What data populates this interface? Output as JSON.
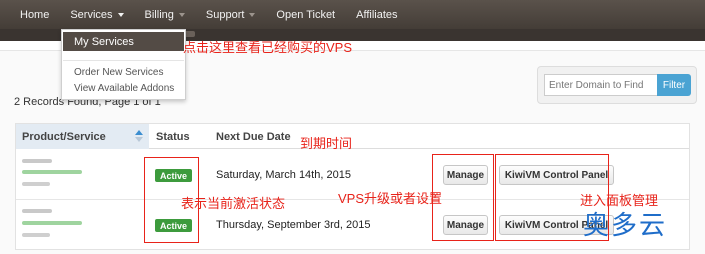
{
  "nav": {
    "items": [
      {
        "label": "Home",
        "caret": false
      },
      {
        "label": "Services",
        "caret": true
      },
      {
        "label": "Billing",
        "caret": true
      },
      {
        "label": "Support",
        "caret": true
      },
      {
        "label": "Open Ticket",
        "caret": false
      },
      {
        "label": "Affiliates",
        "caret": false
      }
    ]
  },
  "dropdown": {
    "active_item": "My Services",
    "items": [
      "Order New Services",
      "View Available Addons"
    ]
  },
  "records_text": "2 Records Found, Page 1 of 1",
  "search": {
    "placeholder": "Enter Domain to Find",
    "filter_label": "Filter"
  },
  "table": {
    "columns": [
      "Product/Service",
      "Status",
      "Next Due Date"
    ],
    "rows": [
      {
        "status": "Active",
        "due_date": "Saturday, March 14th, 2015",
        "manage_label": "Manage",
        "panel_label": "KiwiVM Control Panel"
      },
      {
        "status": "Active",
        "due_date": "Thursday, September 3rd, 2015",
        "manage_label": "Manage",
        "panel_label": "KiwiVM Control Panel"
      }
    ]
  },
  "annotations": {
    "click_here": "点击这里查看已经购买的VPS",
    "due_time": "到期时间",
    "status_hint": "表示当前激活状态",
    "vps_upgrade": "VPS升级或者设置",
    "enter_panel": "进入面板管理"
  },
  "watermark": "奥多云",
  "colors": {
    "nav_bg": "#4d4640",
    "active_badge": "#3d9b3d",
    "filter_button": "#4aa3d3",
    "annotation": "#e8231a",
    "watermark": "#1f6dc9"
  }
}
